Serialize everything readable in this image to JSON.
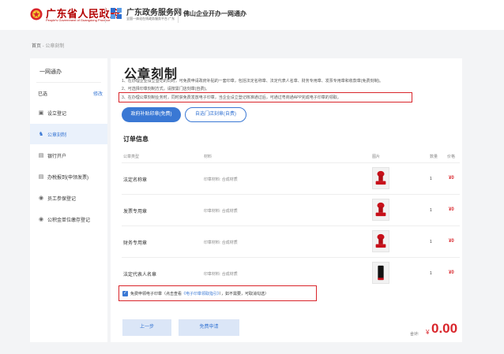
{
  "header": {
    "gov_name": "广东省人民政府",
    "gov_name_en": "People's Government of Guangdong Province",
    "service_name": "广东政务服务网",
    "service_sub": "全国一体化在线政务服务平台 广东",
    "city_title": "佛山企业开办一网通办",
    "emblem_icon": "gov-emblem-icon",
    "service_logo_icon": "service-logo-icon",
    "brand_red": "#b40000"
  },
  "breadcrumb": {
    "home": "首页",
    "separator": " - ",
    "current": "公章刻制"
  },
  "sidebar": {
    "title": "一网通办",
    "selected_label": "已选",
    "modify_label": "修改",
    "items": [
      {
        "label": "设立登记",
        "icon": "building-icon",
        "active": false
      },
      {
        "label": "公章刻制",
        "icon": "stamp-icon",
        "active": true
      },
      {
        "label": "银行开户",
        "icon": "bank-card-icon",
        "active": false
      },
      {
        "label": "办税报到(申领发票)",
        "icon": "tax-icon",
        "active": false
      },
      {
        "label": "员工参保登记",
        "icon": "insurance-icon",
        "active": false
      },
      {
        "label": "公积金单位缴存登记",
        "icon": "fund-icon",
        "active": false
      }
    ]
  },
  "main": {
    "title": "公章刻制",
    "notes": [
      "1、在办理企业设立登记的同时，可免费申请政府补贴的一套印章，包括法定名称章、法定代表人名章、财务专用章、发票专用章和收款章(免费刻制)。",
      "2、可选择印章刻制方式，请按需门店刻章(自费)。",
      "3、在办理公章刻制业务时，同时获免费发放电子印章，当企业设立登记核准通过后，可通过粤商通APP完成电子印章的领取。"
    ],
    "tab_free": "政府补贴印章(免费)",
    "tab_self": "自选门店刻章(自费)",
    "order_title": "订单信息",
    "columns": {
      "type": "公章类型",
      "material": "材料",
      "image": "图片",
      "quantity": "数量",
      "price": "价格"
    },
    "rows": [
      {
        "name": "法定名称章",
        "material": "印章材料: 合成材质",
        "quantity": "1",
        "price": "¥0",
        "image_icon": "red-stamp-icon"
      },
      {
        "name": "发票专用章",
        "material": "印章材料: 合成材质",
        "quantity": "1",
        "price": "¥0",
        "image_icon": "red-stamp-icon"
      },
      {
        "name": "财务专用章",
        "material": "印章材料: 合成材质",
        "quantity": "1",
        "price": "¥0",
        "image_icon": "red-stamp-icon"
      },
      {
        "name": "法定代表人名章",
        "material": "印章材料: 合成材质",
        "quantity": "1",
        "price": "¥0",
        "image_icon": "black-stamp-icon"
      }
    ],
    "checkbox": {
      "checked": true,
      "text_before": "免费申领电子印章（点击查看",
      "link": "《电子印章领取指引》",
      "text_after": "），如不需要，可取消勾选）"
    },
    "btn_prev": "上一步",
    "btn_apply": "免费申请",
    "total_label": "合计:",
    "total_currency": "¥",
    "total_value": "0.00",
    "accent_color": "#3a78d4",
    "highlight_color": "#d9252b"
  }
}
